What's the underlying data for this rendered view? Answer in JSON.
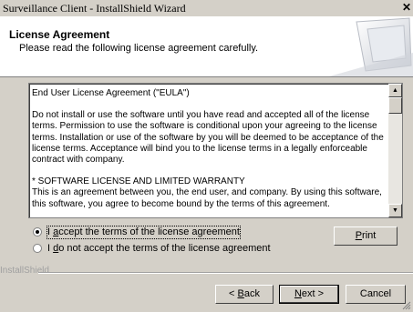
{
  "window": {
    "title": "Surveillance Client - InstallShield Wizard",
    "close_glyph": "✕"
  },
  "header": {
    "title": "License Agreement",
    "subtitle": "Please read the following license agreement carefully."
  },
  "license": {
    "lines": [
      "End User License Agreement (\"EULA\")",
      "",
      "Do not install or use the software until you have read and accepted all of the license terms. Permission to use the software is conditional upon your agreeing to the license terms. Installation or use of the software by you will be deemed to be acceptance of the license terms. Acceptance will bind you to the license terms in a legally enforceable contract with company.",
      "",
      "* SOFTWARE LICENSE AND LIMITED WARRANTY",
      "This is an agreement between you, the end user, and company. By using this software, this software, you agree to become bound by the terms of this agreement."
    ]
  },
  "options": {
    "accept_label_pre": "I ",
    "accept_label_accel": "a",
    "accept_label_post": "ccept the terms of the license agreement",
    "decline_label_pre": "I ",
    "decline_label_accel": "d",
    "decline_label_post": "o not accept the terms of the license agreement",
    "selected": "accept"
  },
  "buttons": {
    "print_accel": "P",
    "print_rest": "rint",
    "back_pre": "< ",
    "back_accel": "B",
    "back_rest": "ack",
    "next_accel": "N",
    "next_rest": "ext >",
    "cancel": "Cancel"
  },
  "footer": {
    "brand": "InstallShield"
  }
}
